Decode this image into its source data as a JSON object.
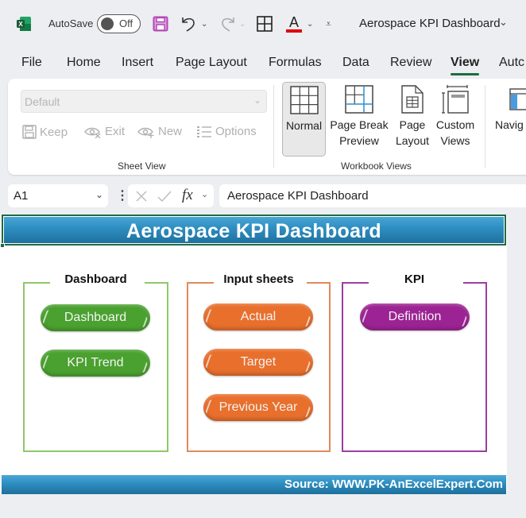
{
  "titlebar": {
    "autosave_label": "AutoSave",
    "autosave_state": "Off",
    "document_title": "Aerospace KPI Dashboard",
    "icons": [
      "excel-logo-icon",
      "save-icon",
      "undo-icon",
      "redo-icon",
      "borders-icon",
      "font-color-icon",
      "customize-qat-icon"
    ]
  },
  "ribbon_tabs": [
    {
      "label": "File"
    },
    {
      "label": "Home"
    },
    {
      "label": "Insert"
    },
    {
      "label": "Page Layout"
    },
    {
      "label": "Formulas"
    },
    {
      "label": "Data"
    },
    {
      "label": "Review"
    },
    {
      "label": "View",
      "active": true
    },
    {
      "label": "Autc"
    }
  ],
  "ribbon": {
    "sheet_view": {
      "select_value": "Default",
      "buttons": [
        {
          "label": "Keep",
          "icon": "keep-icon"
        },
        {
          "label": "Exit",
          "icon": "exit-view-icon"
        },
        {
          "label": "New",
          "icon": "new-view-icon"
        },
        {
          "label": "Options",
          "icon": "options-icon"
        }
      ],
      "group_label": "Sheet View"
    },
    "workbook_views": {
      "buttons": [
        {
          "line1": "Normal",
          "line2": "",
          "selected": true
        },
        {
          "line1": "Page Break",
          "line2": "Preview"
        },
        {
          "line1": "Page",
          "line2": "Layout"
        },
        {
          "line1": "Custom",
          "line2": "Views"
        }
      ],
      "group_label": "Workbook Views"
    },
    "navigation_partial": "Navig"
  },
  "formula_bar": {
    "name_box": "A1",
    "fx_label": "fx",
    "formula": "Aerospace KPI Dashboard"
  },
  "sheet": {
    "banner_title": "Aerospace KPI Dashboard",
    "groups": [
      {
        "title": "Dashboard",
        "color": "#8dc86a",
        "button_color": "#4aa12f",
        "buttons": [
          "Dashboard",
          "KPI Trend"
        ]
      },
      {
        "title": "Input sheets",
        "color": "#e08a5a",
        "button_color": "#e86f2c",
        "buttons": [
          "Actual",
          "Target",
          "Previous Year"
        ]
      },
      {
        "title": "KPI",
        "color": "#9b3fa0",
        "button_color": "#9c2393",
        "buttons": [
          "Definition"
        ]
      }
    ],
    "footer_source": "Source: WWW.PK-AnExcelExpert.Com"
  },
  "colors": {
    "banner_blue": "#2d8dc0",
    "selection_green": "#1e6b41",
    "font_color_red": "#e00000",
    "save_purple": "#b448b8"
  }
}
